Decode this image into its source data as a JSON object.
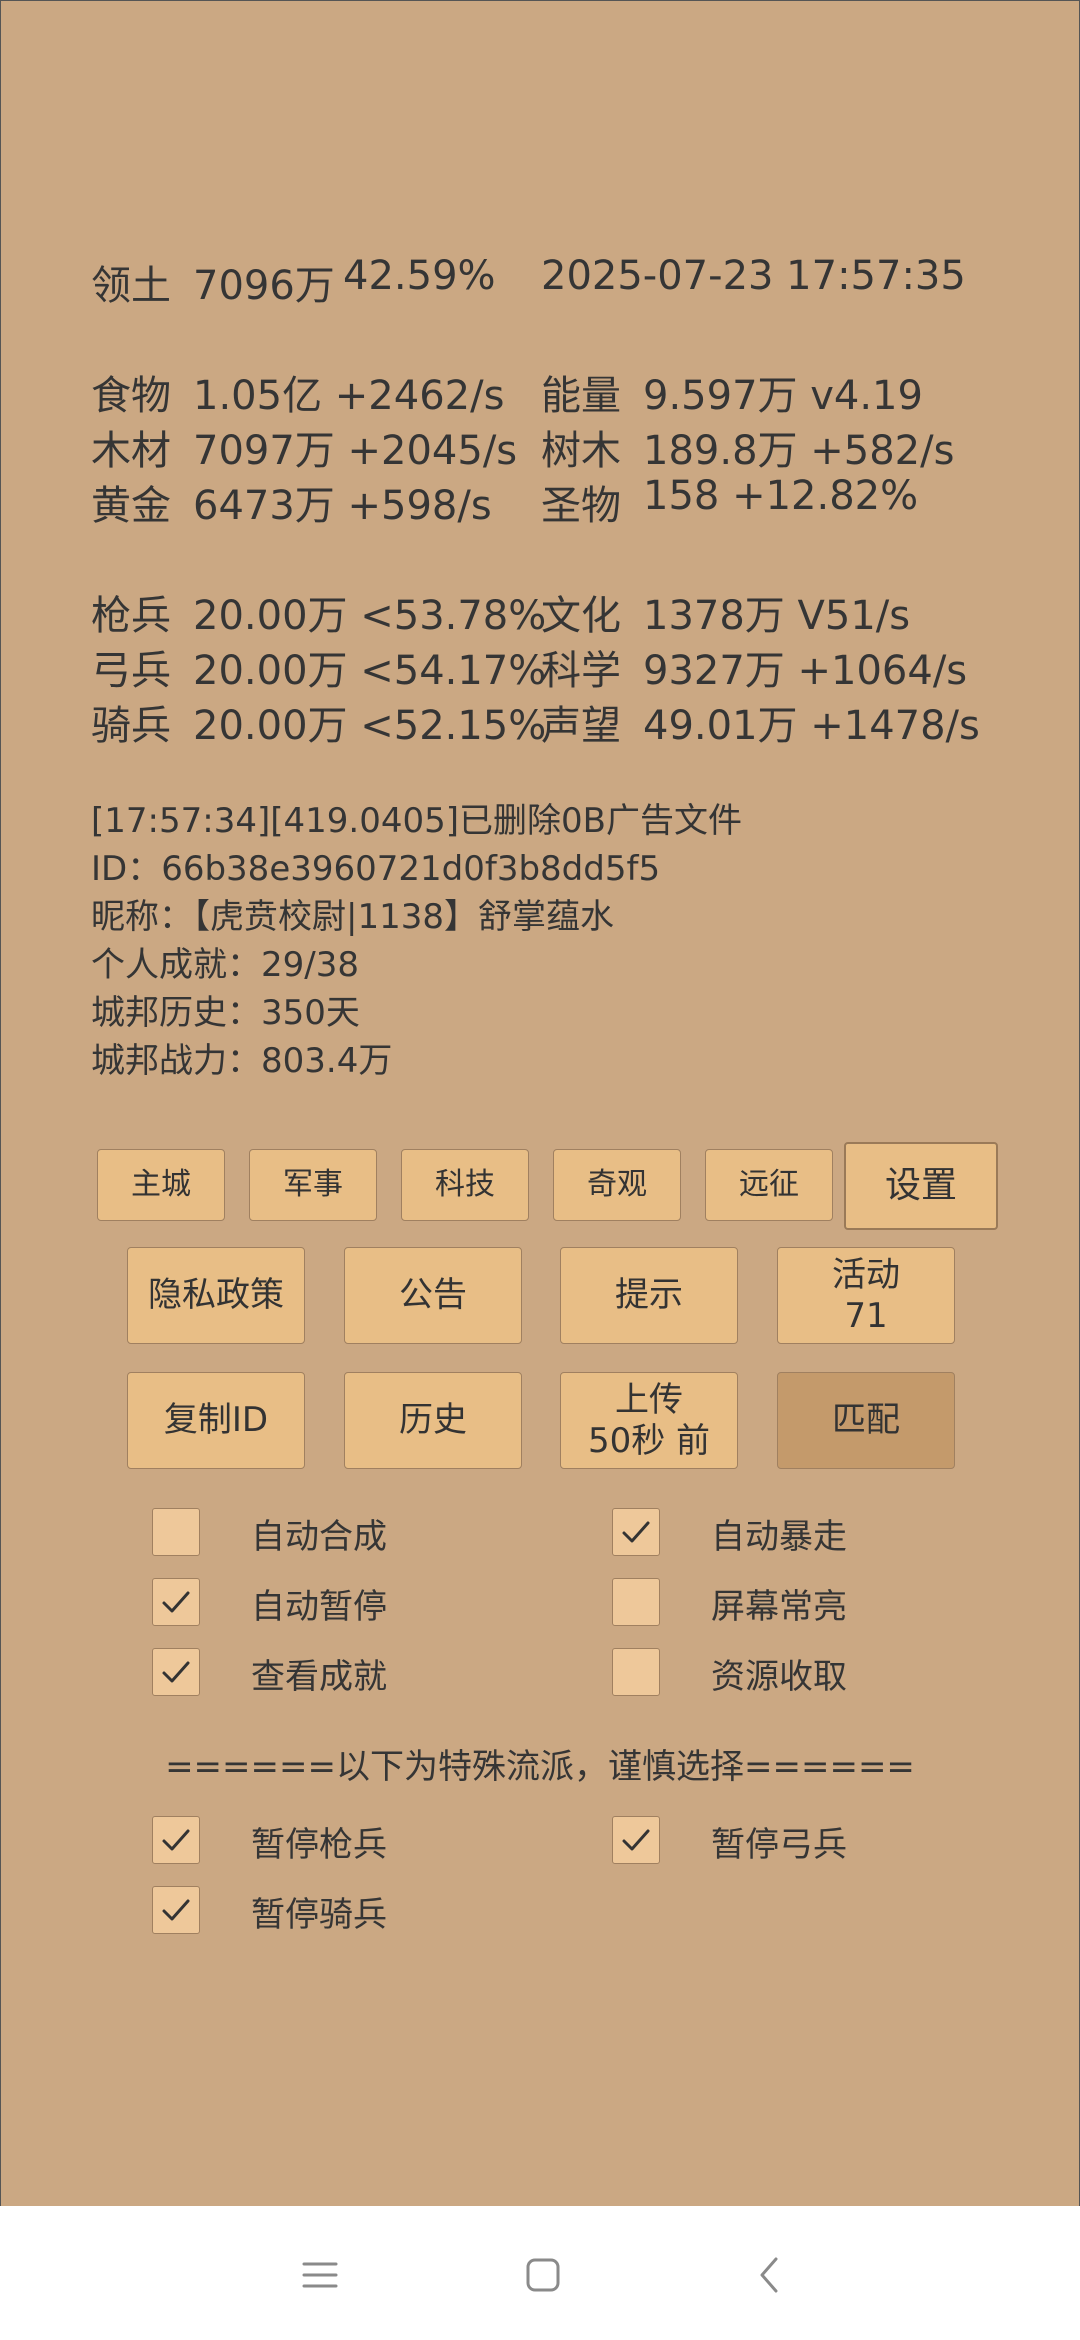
{
  "territory": {
    "label": "领土",
    "value": "7096万",
    "percent": "42.59%",
    "datetime": "2025-07-23 17:57:35"
  },
  "resources": [
    {
      "label": "食物",
      "value": "1.05亿 +2462/s"
    },
    {
      "label": "木材",
      "value": "7097万 +2045/s"
    },
    {
      "label": "黄金",
      "value": "6473万 +598/s"
    },
    {
      "label": "能量",
      "value": "9.597万  v4.19"
    },
    {
      "label": "树木",
      "value": "189.8万 +582/s"
    },
    {
      "label": "圣物",
      "value": "158 +12.82%"
    }
  ],
  "army": [
    {
      "label": "枪兵",
      "value": "20.00万 <53.78%"
    },
    {
      "label": "弓兵",
      "value": "20.00万 <54.17%"
    },
    {
      "label": "骑兵",
      "value": "20.00万 <52.15%"
    },
    {
      "label": "文化",
      "value": "1378万 V51/s"
    },
    {
      "label": "科学",
      "value": "9327万 +1064/s"
    },
    {
      "label": "声望",
      "value": "49.01万 +1478/s"
    }
  ],
  "info": {
    "log": "[17:57:34][419.0405]已删除0B广告文件",
    "id": "ID：66b38e3960721d0f3b8dd5f5",
    "nickname": "昵称：【虎贲校尉|1138】舒掌蕴水",
    "achievement": "个人成就：29/38",
    "history": "城邦历史：350天",
    "power": "城邦战力：803.4万"
  },
  "nav_buttons": [
    "主城",
    "军事",
    "科技",
    "奇观",
    "远征",
    "设置"
  ],
  "row2_buttons": [
    "隐私政策",
    "公告",
    "提示",
    "活动",
    "71"
  ],
  "row3_buttons": [
    "复制ID",
    "历史",
    "上传",
    "50秒 前",
    "匹配"
  ],
  "options": [
    {
      "label": "自动合成",
      "checked": false
    },
    {
      "label": "自动暴走",
      "checked": true
    },
    {
      "label": "自动暂停",
      "checked": true
    },
    {
      "label": "屏幕常亮",
      "checked": false
    },
    {
      "label": "查看成就",
      "checked": true
    },
    {
      "label": "资源收取",
      "checked": false
    }
  ],
  "special_title": "======以下为特殊流派，谨慎选择======",
  "special_options": [
    {
      "label": "暂停枪兵",
      "checked": true
    },
    {
      "label": "暂停弓兵",
      "checked": true
    },
    {
      "label": "暂停骑兵",
      "checked": true
    }
  ],
  "colors": {
    "panel": "#cba883",
    "button": "#e8be86",
    "button_active": "#c49a6b",
    "checkbox": "#eec89a"
  },
  "system_nav": [
    "menu-icon",
    "home-icon",
    "back-icon"
  ]
}
